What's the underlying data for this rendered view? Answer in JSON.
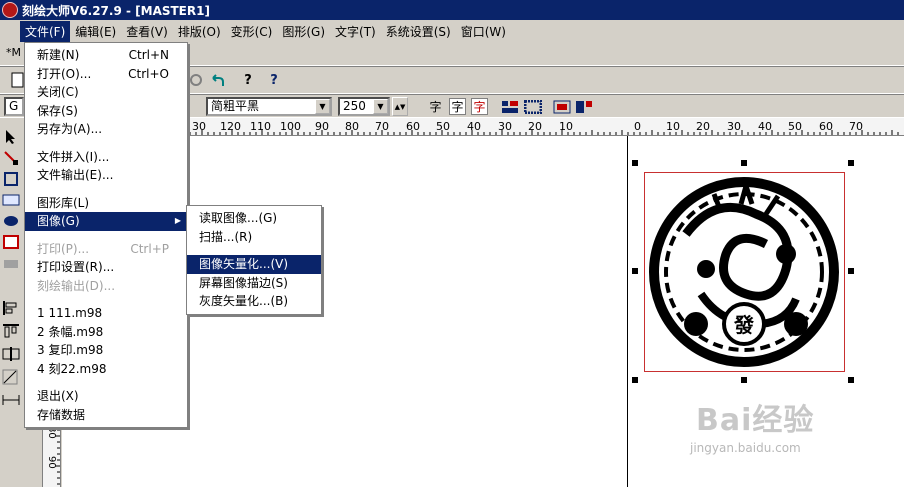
{
  "window": {
    "title": "刻绘大师V6.27.9 - [MASTER1]"
  },
  "menubar": [
    "文件(F)",
    "编辑(E)",
    "查看(V)",
    "排版(O)",
    "变形(C)",
    "图形(G)",
    "文字(T)",
    "系统设置(S)",
    "窗口(W)"
  ],
  "toolbar": {
    "doc_tab": "*M",
    "font_field": "G",
    "font_name": "简粗平黑",
    "font_size": "250",
    "text_style_icons": [
      "字",
      "字",
      "字"
    ],
    "help_icon": "?",
    "context_help_icon": "?"
  },
  "ruler_h_labels": [
    "30",
    "120",
    "110",
    "100",
    "90",
    "80",
    "70",
    "60",
    "50",
    "40",
    "30",
    "20",
    "10",
    "0",
    "10",
    "20",
    "30",
    "40",
    "50",
    "60",
    "70"
  ],
  "ruler_v_labels": [
    "80",
    "90"
  ],
  "file_menu": {
    "items": [
      {
        "label": "新建(N)",
        "shortcut": "Ctrl+N",
        "state": "normal"
      },
      {
        "label": "打开(O)...",
        "shortcut": "Ctrl+O",
        "state": "normal"
      },
      {
        "label": "关闭(C)",
        "shortcut": "",
        "state": "normal"
      },
      {
        "label": "保存(S)",
        "shortcut": "",
        "state": "normal"
      },
      {
        "label": "另存为(A)...",
        "shortcut": "",
        "state": "normal"
      },
      {
        "sep": true
      },
      {
        "label": "文件拼入(I)...",
        "shortcut": "",
        "state": "normal"
      },
      {
        "label": "文件输出(E)...",
        "shortcut": "",
        "state": "normal"
      },
      {
        "sep": true
      },
      {
        "label": "图形库(L)",
        "shortcut": "",
        "state": "normal"
      },
      {
        "label": "图像(G)",
        "shortcut": "",
        "state": "highlighted",
        "submenu": true
      },
      {
        "sep": true
      },
      {
        "label": "打印(P)...",
        "shortcut": "Ctrl+P",
        "state": "disabled"
      },
      {
        "label": "打印设置(R)...",
        "shortcut": "",
        "state": "normal"
      },
      {
        "label": "刻绘输出(D)...",
        "shortcut": "",
        "state": "disabled"
      },
      {
        "sep": true
      },
      {
        "label": "1 111.m98",
        "shortcut": "",
        "state": "normal"
      },
      {
        "label": "2 条幅.m98",
        "shortcut": "",
        "state": "normal"
      },
      {
        "label": "3 复印.m98",
        "shortcut": "",
        "state": "normal"
      },
      {
        "label": "4 刻22.m98",
        "shortcut": "",
        "state": "normal"
      },
      {
        "sep": true
      },
      {
        "label": "退出(X)",
        "shortcut": "",
        "state": "normal"
      },
      {
        "label": "存储数据",
        "shortcut": "",
        "state": "normal"
      }
    ]
  },
  "image_submenu": {
    "items": [
      {
        "label": "读取图像...(G)",
        "state": "normal"
      },
      {
        "label": "扫描...(R)",
        "state": "normal"
      },
      {
        "sep": true
      },
      {
        "label": "图像矢量化...(V)",
        "state": "highlighted"
      },
      {
        "label": "屏幕图像描边(S)",
        "state": "normal"
      },
      {
        "label": "灰度矢量化...(B)",
        "state": "normal"
      }
    ]
  },
  "canvas": {
    "artwork": "dragon-papercut",
    "center_character": "發"
  },
  "watermark": {
    "brand": "Bai经验",
    "url": "jingyan.baidu.com"
  },
  "colors": {
    "title_bar": "#0a246a",
    "menu_highlight": "#0a246a",
    "selection_border": "#c83030",
    "chrome": "#d4d0c8"
  }
}
